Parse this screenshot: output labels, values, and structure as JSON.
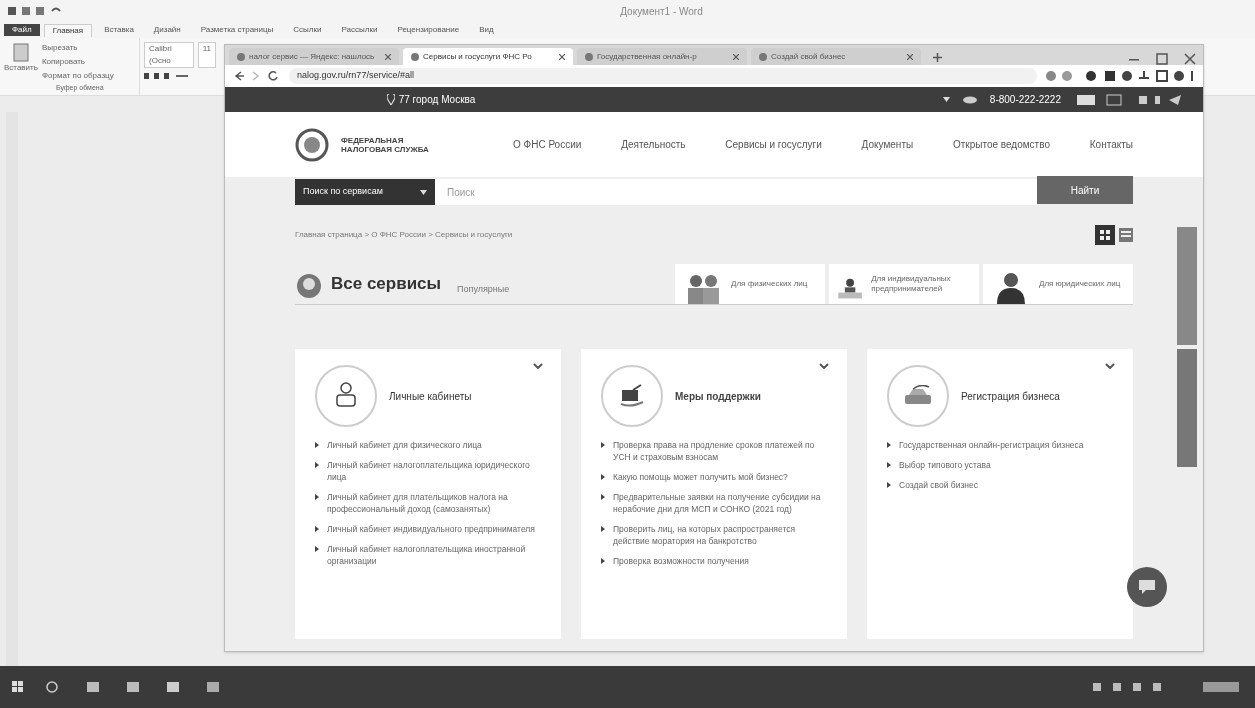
{
  "word": {
    "title": "Документ1 - Word",
    "ribbon_tabs": [
      {
        "label": "Файл",
        "selected": false,
        "kind": "file"
      },
      {
        "label": "Главная",
        "selected": true,
        "kind": "tab"
      },
      {
        "label": "Вставка",
        "selected": false,
        "kind": "tab"
      },
      {
        "label": "Дизайн",
        "selected": false,
        "kind": "tab"
      },
      {
        "label": "Разметка страницы",
        "selected": false,
        "kind": "tab"
      },
      {
        "label": "Ссылки",
        "selected": false,
        "kind": "tab"
      },
      {
        "label": "Рассылки",
        "selected": false,
        "kind": "tab"
      },
      {
        "label": "Рецензирование",
        "selected": false,
        "kind": "tab"
      },
      {
        "label": "Вид",
        "selected": false,
        "kind": "tab"
      }
    ],
    "clipboard": {
      "paste": "Вставить",
      "items": [
        "Вырезать",
        "Копировать",
        "Формат по образцу"
      ],
      "group": "Буфер обмена"
    },
    "font": {
      "name": "Calibri (Осно",
      "size": "11"
    }
  },
  "browser": {
    "tabs": [
      {
        "label": "налог сервис — Яндекс: нашлось",
        "selected": false
      },
      {
        "label": "Сервисы и госуслуги ФНС Ро",
        "selected": true
      },
      {
        "label": "Государственная онлайн-р",
        "selected": false
      },
      {
        "label": "Создай свой бизнес",
        "selected": false
      }
    ],
    "url": "nalog.gov.ru/rn77/service/#all"
  },
  "site": {
    "region": "77 город Москва",
    "phone": "8-800-222-2222",
    "logo": [
      "ФЕДЕРАЛЬНАЯ",
      "НАЛОГОВАЯ СЛУЖБА"
    ],
    "nav": [
      "О ФНС России",
      "Деятельность",
      "Сервисы и госуслуги",
      "Документы",
      "Открытое ведомство",
      "Контакты"
    ],
    "search": {
      "scope": "Поиск по сервисам",
      "placeholder": "Поиск",
      "button": "Найти"
    },
    "breadcrumb": "Главная страница > О ФНС России > Сервисы и госуслуги",
    "view_toggle": [
      {
        "kind": "grid",
        "selected": true
      },
      {
        "kind": "list",
        "selected": false
      }
    ],
    "filters": [
      {
        "label": "Все сервисы",
        "selected": true
      },
      {
        "label": "Популярные",
        "selected": false
      }
    ],
    "audiences": [
      {
        "label": "Для физических лиц",
        "kind": "people"
      },
      {
        "label": "Для индивидуальных предпринимателей",
        "kind": "entrepreneur"
      },
      {
        "label": "Для юридических лиц",
        "kind": "businessman"
      }
    ],
    "cards": [
      {
        "title": "Личные кабинеты",
        "kind": "cabinet",
        "links": [
          "Личный кабинет для физического лица",
          "Личный кабинет налогоплательщика юридического лица",
          "Личный кабинет для плательщиков налога на профессиональный доход (самозанятых)",
          "Личный кабинет индивидуального предпринимателя",
          "Личный кабинет налогоплательщика иностранной организации"
        ]
      },
      {
        "title": "Меры поддержки",
        "kind": "support",
        "links": [
          "Проверка права на продление сроков платежей по УСН и страховым взносам",
          "Какую помощь может получить мой бизнес?",
          "Предварительные заявки на получение субсидии на нерабочие дни для МСП и СОНКО (2021 год)",
          "Проверить лиц, на которых распространяется действие моратория на банкротство",
          "Проверка возможности получения"
        ]
      },
      {
        "title": "Регистрация бизнеса",
        "kind": "registration",
        "links": [
          "Государственная онлайн-регистрация бизнеса",
          "Выбор типового устава",
          "Создай свой бизнес"
        ]
      }
    ]
  }
}
